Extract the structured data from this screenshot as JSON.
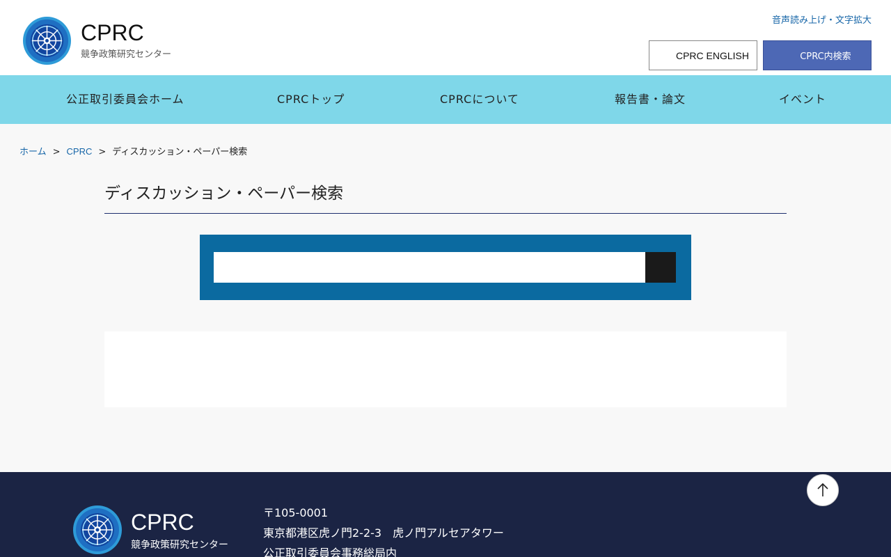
{
  "header": {
    "site_name": "CPRC",
    "site_subtitle": "競争政策研究センター",
    "a11y_link": "音声読み上げ・文字拡大",
    "english_button": "CPRC ENGLISH",
    "search_button": "CPRC内検索"
  },
  "nav": {
    "items": [
      {
        "label": "公正取引委員会ホーム"
      },
      {
        "label": "CPRCトップ"
      },
      {
        "label": "CPRCについて"
      },
      {
        "label": "報告書・論文"
      },
      {
        "label": "イベント"
      }
    ]
  },
  "breadcrumb": {
    "home": "ホーム",
    "cprc": "CPRC",
    "separator": ">",
    "current": "ディスカッション・ペーパー検索"
  },
  "page": {
    "title": "ディスカッション・ペーパー検索"
  },
  "search": {
    "value": "",
    "placeholder": ""
  },
  "footer": {
    "site_name": "CPRC",
    "site_subtitle": "競争政策研究センター",
    "postal": "〒105-0001",
    "address": "東京都港区虎ノ門2-2-3　虎ノ門アルセアタワー",
    "office": "公正取引委員会事務総局内"
  },
  "colors": {
    "nav_bg": "#7fd7e9",
    "search_panel": "#0b6aa0",
    "search_button_bg": "#4d68b5",
    "footer_bg": "#1b2444",
    "link": "#1766a8"
  },
  "icons": {
    "logo": "cprc-emblem-icon",
    "back_to_top": "arrow-up-icon"
  }
}
